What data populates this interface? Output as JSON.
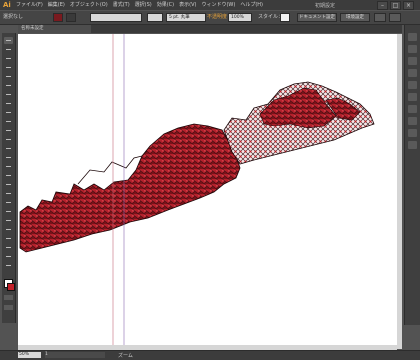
{
  "app": {
    "logo": "Ai",
    "mode": "初期設定"
  },
  "menu": [
    "ファイル(F)",
    "編集(E)",
    "オブジェクト(O)",
    "書式(T)",
    "選択(S)",
    "効果(C)",
    "表示(V)",
    "ウィンドウ(W)",
    "ヘルプ(H)"
  ],
  "window_controls": {
    "minimize": "–",
    "maximize": "□",
    "close": "×"
  },
  "control_bar": {
    "selection_label": "選択なし",
    "stroke_weight": "5 pt. 丸筆",
    "opacity_label": "不透明度",
    "opacity_value": "100%",
    "style_label": "スタイル：",
    "doc_setup_button": "ドキュメント設定",
    "prefs_button": "環境設定"
  },
  "document_tab": "名称未設定",
  "status": {
    "zoom_value": "50%",
    "page_value": "1",
    "tool_label": "ズーム"
  },
  "colors": {
    "accent": "#e8a33a",
    "art_fill": "#b3212c",
    "art_dark": "#2a0a0d",
    "guide": "#c46a7a"
  },
  "icons": [
    "selection-icon",
    "direct-select-icon",
    "magic-wand-icon",
    "pen-icon",
    "type-icon",
    "line-icon",
    "rectangle-icon",
    "brush-icon",
    "pencil-icon",
    "eraser-icon",
    "rotate-icon",
    "scale-icon",
    "width-icon",
    "free-transform-icon",
    "shape-builder-icon",
    "perspective-icon",
    "mesh-icon",
    "gradient-icon",
    "eyedropper-icon",
    "blend-icon",
    "symbol-sprayer-icon",
    "graph-icon",
    "artboard-icon",
    "slice-icon",
    "hand-icon",
    "zoom-icon"
  ]
}
